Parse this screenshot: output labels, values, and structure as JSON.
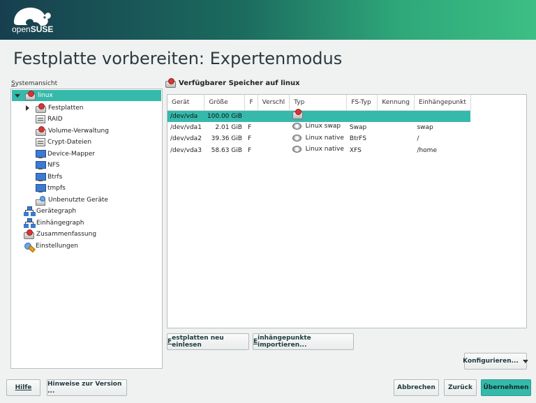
{
  "brand": {
    "logo_prefix": "open",
    "logo_suffix": "SUSE"
  },
  "page_title": "Festplatte vorbereiten: Expertenmodus",
  "sidebar": {
    "label": "Systemansicht",
    "items": [
      {
        "label": "linux",
        "icon": "disk-red-icon",
        "selected": true,
        "expander": "expanded"
      },
      {
        "label": "Festplatten",
        "icon": "disk-red-icon",
        "expander": "collapsed"
      },
      {
        "label": "RAID",
        "icon": "raid-icon"
      },
      {
        "label": "Volume-Verwaltung",
        "icon": "volume-icon"
      },
      {
        "label": "Crypt-Dateien",
        "icon": "crypt-icon"
      },
      {
        "label": "Device-Mapper",
        "icon": "device-mapper-icon"
      },
      {
        "label": "NFS",
        "icon": "nfs-icon"
      },
      {
        "label": "Btrfs",
        "icon": "btrfs-icon"
      },
      {
        "label": "tmpfs",
        "icon": "tmpfs-icon"
      },
      {
        "label": "Unbenutzte Geräte",
        "icon": "unused-devices-icon"
      },
      {
        "label": "Gerätegraph",
        "icon": "graph-icon"
      },
      {
        "label": "Einhängegraph",
        "icon": "graph-icon"
      },
      {
        "label": "Zusammenfassung",
        "icon": "summary-icon"
      },
      {
        "label": "Einstellungen",
        "icon": "settings-icon"
      }
    ]
  },
  "main": {
    "section_title": "Verfügbarer Speicher auf linux",
    "columns": [
      "Gerät",
      "Größe",
      "F",
      "Verschl",
      "Typ",
      "FS-Typ",
      "Kennung",
      "Einhängepunkt"
    ],
    "rows": [
      {
        "device": "/dev/vda",
        "size": "100.00 GiB",
        "f": "",
        "enc": "",
        "type": "",
        "fstype": "",
        "label": "",
        "mount": "",
        "selected": true,
        "icon": "disk-red-icon"
      },
      {
        "device": "/dev/vda1",
        "size": "2.01 GiB",
        "f": "F",
        "enc": "",
        "type": "Linux swap",
        "fstype": "Swap",
        "label": "",
        "mount": "swap",
        "icon": "hdd-icon"
      },
      {
        "device": "/dev/vda2",
        "size": "39.36 GiB",
        "f": "F",
        "enc": "",
        "type": "Linux native",
        "fstype": "BtrFS",
        "label": "",
        "mount": "/",
        "icon": "hdd-icon"
      },
      {
        "device": "/dev/vda3",
        "size": "58.63 GiB",
        "f": "F",
        "enc": "",
        "type": "Linux native",
        "fstype": "XFS",
        "label": "",
        "mount": "/home",
        "icon": "hdd-icon"
      }
    ],
    "rescan_button": "Festplatten neu einlesen",
    "import_button": "Einhängepunkte importieren...",
    "configure_button": "Konfigurieren..."
  },
  "footer": {
    "help": "Hilfe",
    "release_notes": "Hinweise zur Version ...",
    "abort": "Abbrechen",
    "back": "Zurück",
    "accept": "Übernehmen"
  },
  "colors": {
    "accent": "#35b9ab",
    "banner_start": "#173f4f",
    "banner_end": "#3cbf84",
    "title": "#2b3b3f"
  }
}
